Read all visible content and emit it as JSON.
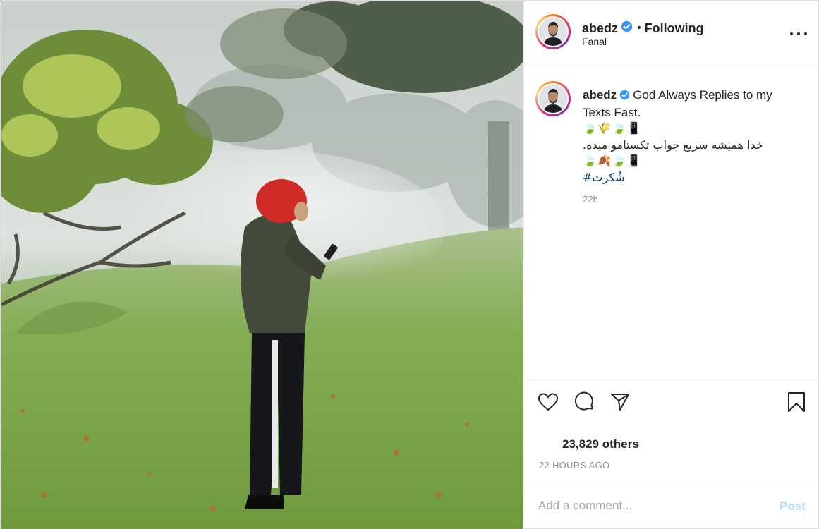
{
  "post": {
    "username": "abedz",
    "separator": "•",
    "follow_status": "Following",
    "location": "Fanal",
    "caption": {
      "line1": "God Always Replies to my Texts Fast.",
      "emoji1": "🍃🌾🍃📱",
      "line2": "خدا همیشه سریع جواب تکستامو میده.",
      "emoji2": "🍃🍂🍃📱",
      "hashtag": "#شُکرت"
    },
    "time_short": "22h",
    "likes": "23,829 others",
    "time_long": "22 HOURS AGO",
    "comment_placeholder": "Add a comment...",
    "post_label": "Post"
  },
  "icons": {
    "verified": "verified-badge-icon",
    "more": "more-options-icon",
    "like": "heart-icon",
    "comment": "comment-icon",
    "share": "share-icon",
    "save": "bookmark-icon"
  },
  "colors": {
    "verified_blue": "#3897f0",
    "link_blue": "#00376b",
    "post_button": "#b2dffc",
    "muted_text": "#8e8e8e",
    "border": "#efefef"
  }
}
